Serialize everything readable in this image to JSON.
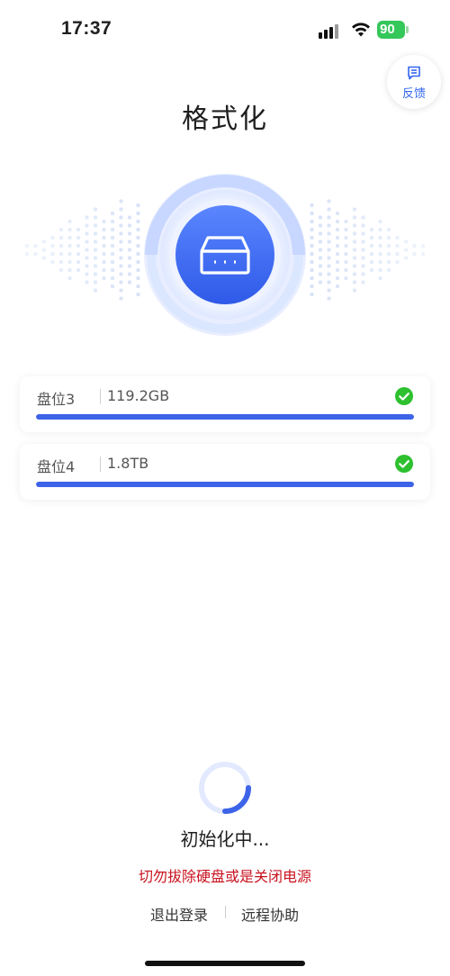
{
  "status_bar": {
    "time": "17:37",
    "battery": "90",
    "icons": [
      "signal-icon",
      "wifi-icon",
      "battery-icon"
    ]
  },
  "feedback": {
    "label": "反馈",
    "icon": "feedback-icon"
  },
  "page": {
    "title": "格式化"
  },
  "hero": {
    "icon": "drive-box-icon",
    "accent": "#3d63e8"
  },
  "disks": [
    {
      "label": "盘位3",
      "size": "119.2GB",
      "progress": 1.0,
      "status": "done"
    },
    {
      "label": "盘位4",
      "size": "1.8TB",
      "progress": 1.0,
      "status": "done"
    }
  ],
  "progress": {
    "text": "初始化中...",
    "warning": "切勿拔除硬盘或是关闭电源"
  },
  "footer": {
    "logout_label": "退出登录",
    "remote_help_label": "远程协助"
  },
  "colors": {
    "accent": "#3d63e8",
    "success": "#2ec02e",
    "warning": "#c8131f"
  }
}
